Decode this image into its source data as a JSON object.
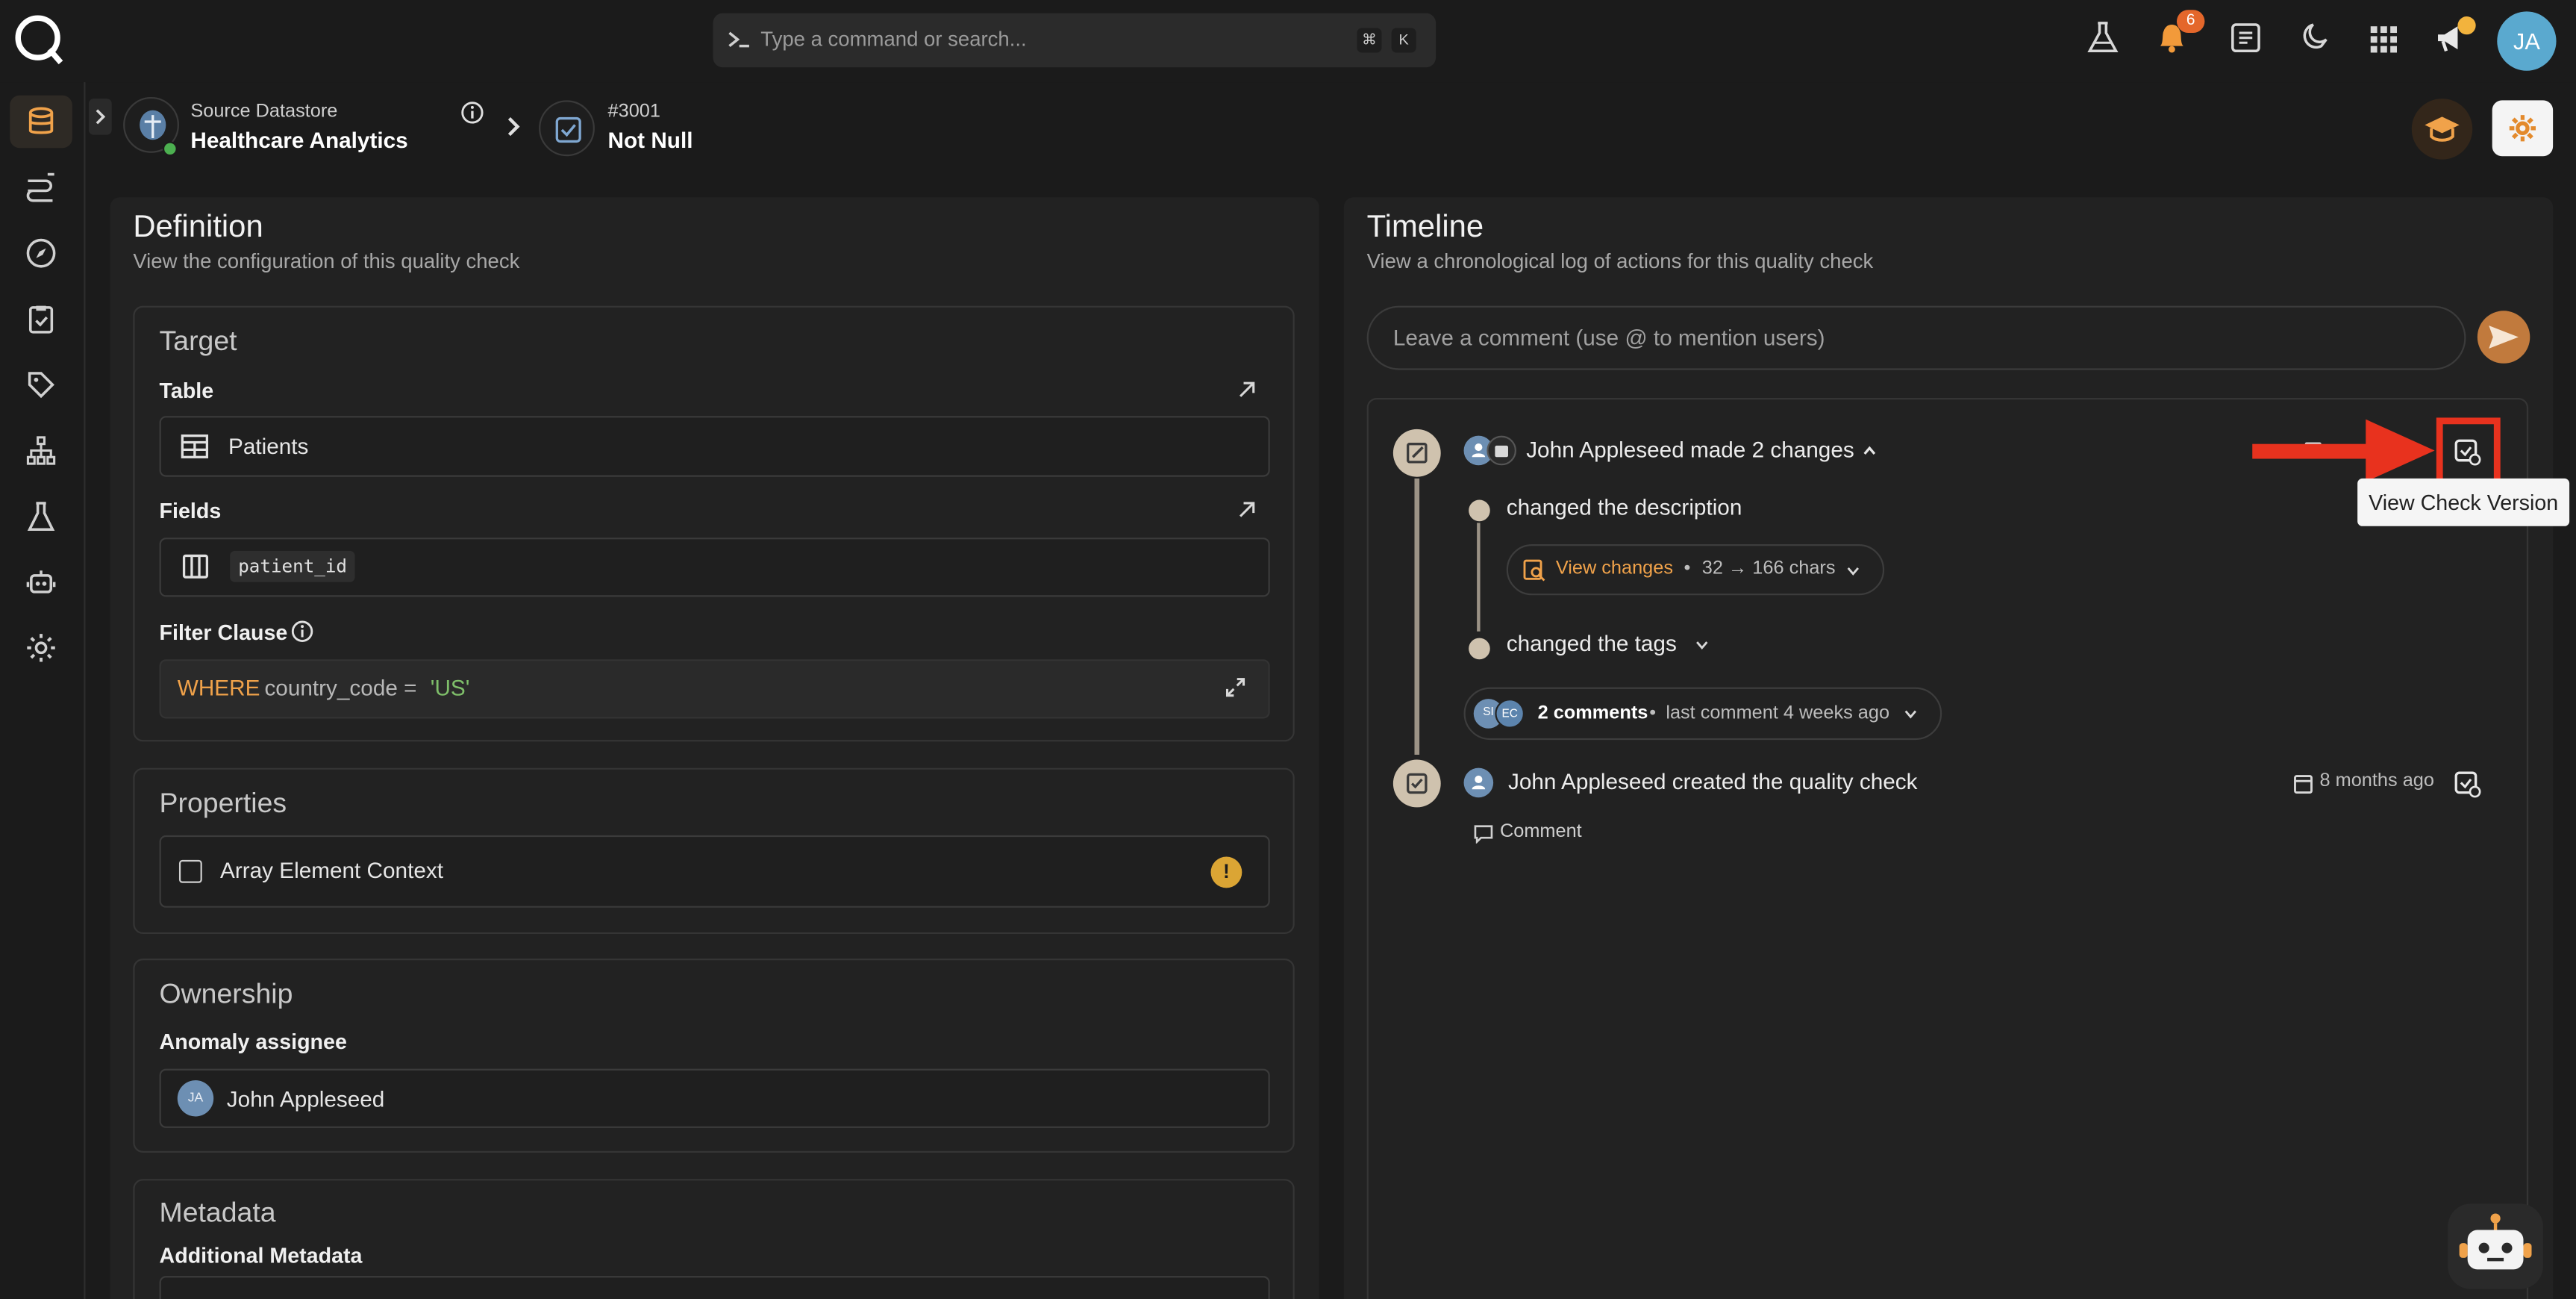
{
  "search": {
    "placeholder": "Type a command or search...",
    "shortcut_key1": "⌘",
    "shortcut_key2": "K"
  },
  "topbar": {
    "notification_count": "6",
    "user_initials": "JA"
  },
  "breadcrumb": {
    "datastore_label": "Source Datastore",
    "datastore_name": "Healthcare Analytics",
    "check_id": "#3001",
    "check_name": "Not Null"
  },
  "definition": {
    "title": "Definition",
    "subtitle": "View the configuration of this quality check",
    "target": {
      "title": "Target",
      "table_label": "Table",
      "table_value": "Patients",
      "fields_label": "Fields",
      "field_value": "patient_id",
      "filter_label": "Filter Clause",
      "filter_keyword": "WHERE",
      "filter_expr": "country_code = ",
      "filter_literal": "'US'"
    },
    "properties": {
      "title": "Properties",
      "option_label": "Array Element Context"
    },
    "ownership": {
      "title": "Ownership",
      "assignee_label": "Anomaly assignee",
      "assignee_initials": "JA",
      "assignee_name": "John Appleseed"
    },
    "metadata": {
      "title": "Metadata",
      "additional_label": "Additional Metadata"
    }
  },
  "timeline": {
    "title": "Timeline",
    "subtitle": "View a chronological log of actions for this quality check",
    "comment_placeholder": "Leave a comment (use @ to mention users)",
    "events": [
      {
        "header": "John Appleseed made 2 changes",
        "change1": "changed the description",
        "view_changes_label": "View changes",
        "view_changes_detail": "32 → 166 chars",
        "change2": "changed the tags",
        "comments_count": "2 comments",
        "comments_last": "last comment 4 weeks ago",
        "commenter_initials": [
          "SI",
          "EC"
        ]
      },
      {
        "header": "John Appleseed created the quality check",
        "time": "8 months ago",
        "comment_action": "Comment"
      }
    ],
    "tooltip": "View Check Version"
  },
  "colors": {
    "accent": "#f0a24a",
    "highlight": "#e8321e"
  }
}
